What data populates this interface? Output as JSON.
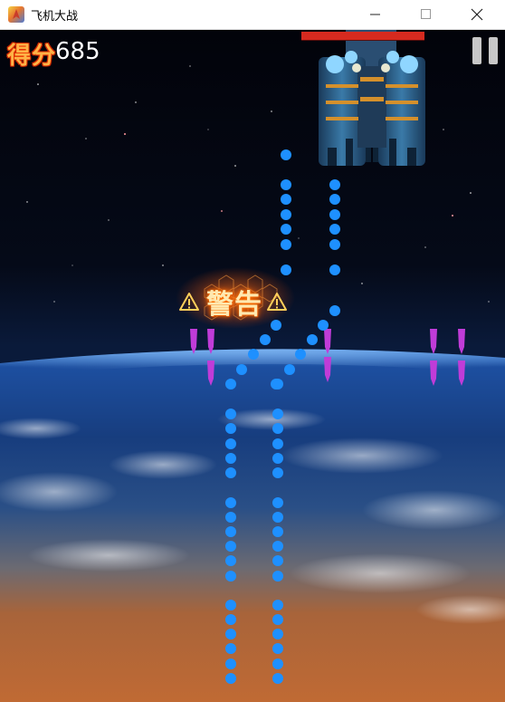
{
  "window": {
    "title": "飞机大战",
    "icon": "game-app-icon",
    "controls": [
      "minimize-icon",
      "maximize-icon",
      "close-icon"
    ]
  },
  "hud": {
    "score_label": "得分",
    "score_value": "685",
    "pause_icon": "pause-icon",
    "boss_health_fraction": 1.0
  },
  "warning": {
    "text": "警告",
    "icon": "warning-triangle-icon"
  },
  "colors": {
    "bullet": "#1e90ff",
    "enemy_bullet": "#c03cd8",
    "warning": "#ff8a1e",
    "health": "#c0201a",
    "score_label": "#ffb347"
  }
}
